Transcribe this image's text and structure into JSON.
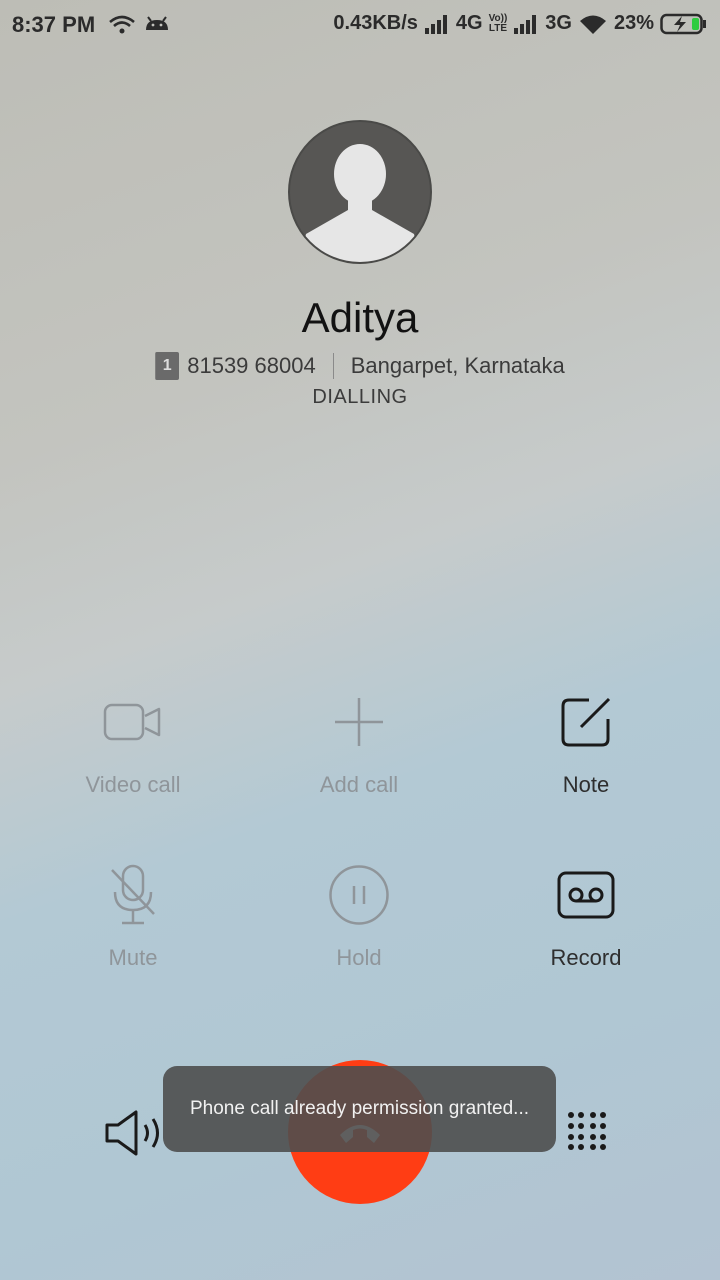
{
  "status_bar": {
    "time": "8:37 PM",
    "net_speed": "0.43KB/s",
    "network1": "4G",
    "volte_top": "Vo))",
    "volte_bottom": "LTE",
    "network2": "3G",
    "battery": "23%"
  },
  "contact": {
    "name": "Aditya",
    "sim": "1",
    "number": "81539 68004",
    "location": "Bangarpet, Karnataka",
    "call_status": "DIALLING"
  },
  "controls": {
    "video_call": "Video call",
    "add_call": "Add call",
    "note": "Note",
    "mute": "Mute",
    "hold": "Hold",
    "record": "Record"
  },
  "toast": {
    "message": "Phone call already permission granted..."
  },
  "colors": {
    "end_call": "#ff3d14",
    "disabled": "#8f959a",
    "enabled": "#2e2e2e"
  }
}
